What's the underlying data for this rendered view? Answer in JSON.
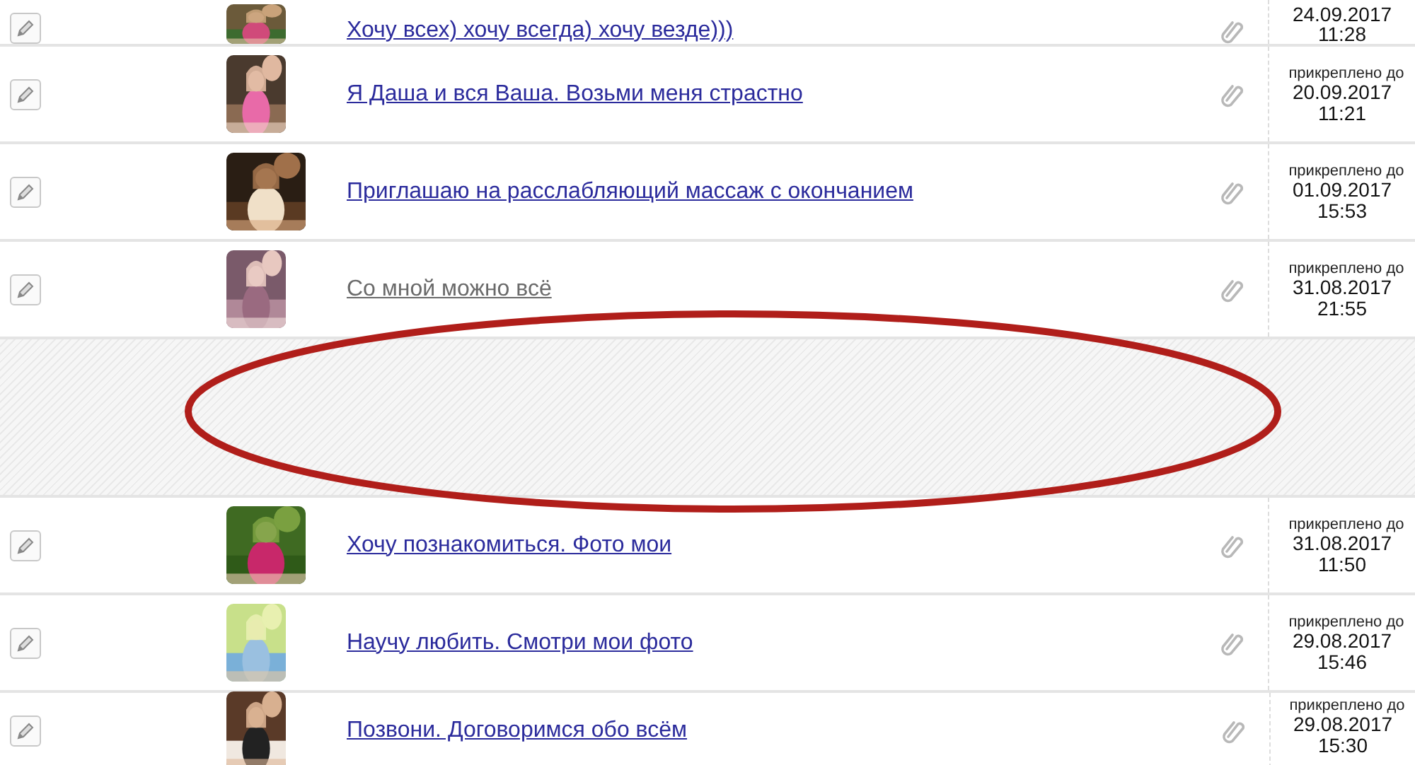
{
  "rows": [
    {
      "kind": "listing",
      "title": "Хочу всех) хочу всегда) хочу везде)))",
      "visited": false,
      "date": "24.09.2017",
      "time": "11:28"
    },
    {
      "kind": "listing",
      "title": "Я Даша и вся Ваша. Возьми меня страстно",
      "visited": false,
      "pinned_label": "прикреплено до",
      "date": "20.09.2017",
      "time": "11:21"
    },
    {
      "kind": "listing",
      "title": "Приглашаю на расслабляющий массаж с окончанием",
      "visited": false,
      "pinned_label": "прикреплено до",
      "date": "01.09.2017",
      "time": "15:53"
    },
    {
      "kind": "listing",
      "title": "Со мной можно всё",
      "visited": true,
      "pinned_label": "прикреплено до",
      "date": "31.08.2017",
      "time": "21:55"
    },
    {
      "kind": "hidden"
    },
    {
      "kind": "listing",
      "title": "Хочу познакомиться. Фото мои",
      "visited": false,
      "pinned_label": "прикреплено до",
      "date": "31.08.2017",
      "time": "11:50"
    },
    {
      "kind": "listing",
      "title": "Научу любить. Смотри мои фото",
      "visited": false,
      "pinned_label": "прикреплено до",
      "date": "29.08.2017",
      "time": "15:46"
    },
    {
      "kind": "listing",
      "title": "Позвони. Договоримся обо всём",
      "visited": false,
      "pinned_label": "прикреплено до",
      "date": "29.08.2017",
      "time": "15:30"
    }
  ]
}
